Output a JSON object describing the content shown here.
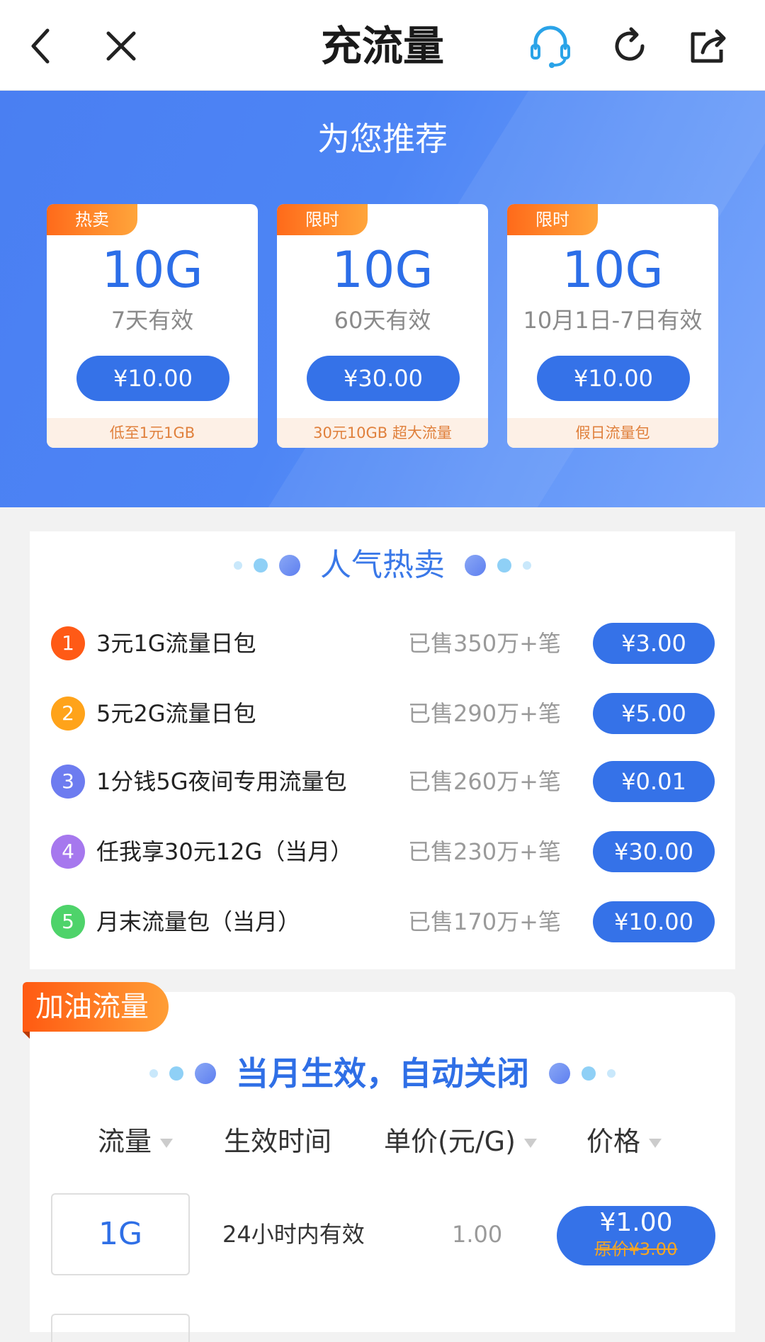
{
  "nav": {
    "title": "充流量",
    "icons": [
      "back-arrow-icon",
      "close-icon",
      "headset-icon",
      "refresh-icon",
      "share-icon"
    ]
  },
  "recommend": {
    "title": "为您推荐",
    "cards": [
      {
        "tag": "热卖",
        "amount": "10G",
        "validity": "7天有效",
        "price": "¥10.00",
        "note": "低至1元1GB"
      },
      {
        "tag": "限时",
        "amount": "10G",
        "validity": "60天有效",
        "price": "¥30.00",
        "note": "30元10GB 超大流量"
      },
      {
        "tag": "限时",
        "amount": "10G",
        "validity": "10月1日-7日有效",
        "price": "¥10.00",
        "note": "假日流量包"
      }
    ]
  },
  "popular": {
    "title": "人气热卖",
    "items": [
      {
        "rank": "1",
        "name": "3元1G流量日包",
        "sold": "已售350万+笔",
        "price": "¥3.00"
      },
      {
        "rank": "2",
        "name": "5元2G流量日包",
        "sold": "已售290万+笔",
        "price": "¥5.00"
      },
      {
        "rank": "3",
        "name": "1分钱5G夜间专用流量包",
        "sold": "已售260万+笔",
        "price": "¥0.01"
      },
      {
        "rank": "4",
        "name": "任我享30元12G（当月）",
        "sold": "已售230万+笔",
        "price": "¥30.00"
      },
      {
        "rank": "5",
        "name": "月末流量包（当月）",
        "sold": "已售170万+笔",
        "price": "¥10.00"
      }
    ]
  },
  "boost": {
    "tag": "加油流量",
    "title": "当月生效，自动关闭",
    "columns": [
      "流量",
      "生效时间",
      "单价(元/G)",
      "价格"
    ],
    "rows": [
      {
        "volume": "1G",
        "effect": "24小时内有效",
        "unit_price": "1.00",
        "price": "¥1.00",
        "original_price": "原价¥3.00"
      }
    ]
  },
  "colors": {
    "primary_blue": "#3572e8",
    "banner_blue": "#4a7ff2",
    "tag_orange": "#ff7a22",
    "rank_colors": [
      "#ff5a16",
      "#ffa31a",
      "#6d7cf0",
      "#a678ee",
      "#4ed36a"
    ]
  }
}
